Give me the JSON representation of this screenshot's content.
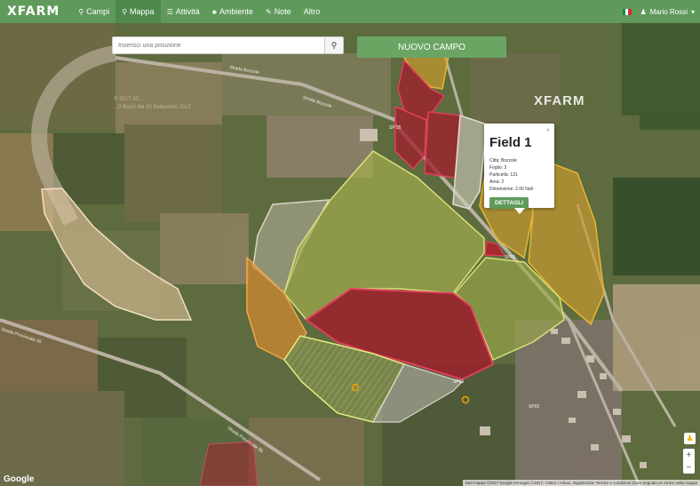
{
  "nav": {
    "logo": "XFARM",
    "items": [
      {
        "icon": "pin-icon",
        "glyph": "⚲",
        "label": "Campi"
      },
      {
        "icon": "map-marker-icon",
        "glyph": "⚲",
        "label": "Mappa"
      },
      {
        "icon": "list-icon",
        "glyph": "☰",
        "label": "Attività"
      },
      {
        "icon": "leaf-icon",
        "glyph": "♣",
        "label": "Ambiente"
      },
      {
        "icon": "note-icon",
        "glyph": "✎",
        "label": "Note"
      },
      {
        "icon": "",
        "glyph": "",
        "label": "Altro"
      }
    ],
    "active_index": 1,
    "user_name": "Mario Rossi",
    "user_caret": "▾"
  },
  "search": {
    "placeholder": "Inserisci una posizione",
    "button_icon": "search-icon"
  },
  "new_field_button": "NUOVO CAMPO",
  "watermark": "XFARM",
  "imagery": {
    "line1": "© 2017 XF...",
    "line2": "...0 Bozzi del 20 Settembre 2017"
  },
  "popup": {
    "close": "×",
    "title": "Field 1",
    "lines": [
      "Città: Bozzole",
      "Foglio: 3",
      "Particella: 131",
      "Area: 2",
      "Dimensione: 2.00 Nah"
    ],
    "button": "DETTAGLI"
  },
  "roads": [
    {
      "label": "Strada Bozzole"
    },
    {
      "label": "Strada Bozzole"
    },
    {
      "label": "SP 55"
    },
    {
      "label": "SP55"
    },
    {
      "label": "SP55"
    },
    {
      "label": "SP55"
    },
    {
      "label": "Strada Provinciale 55"
    },
    {
      "label": "Strada Provinciale 55"
    }
  ],
  "attribution": {
    "google": "Google",
    "footer": "Dati mappa ©2017 Google Immagini ©2017, CNES / Airbus, DigitalGlobe   Termini e condizioni d'uso   Segnala un errore nella mappa"
  },
  "zoom": {
    "in": "+",
    "out": "−"
  },
  "colors": {
    "nav": "#5f9a5b",
    "field_green": "#9aa84a",
    "field_red": "#b3202e",
    "field_orange": "#d98a30",
    "field_yellow": "#d7b330"
  }
}
